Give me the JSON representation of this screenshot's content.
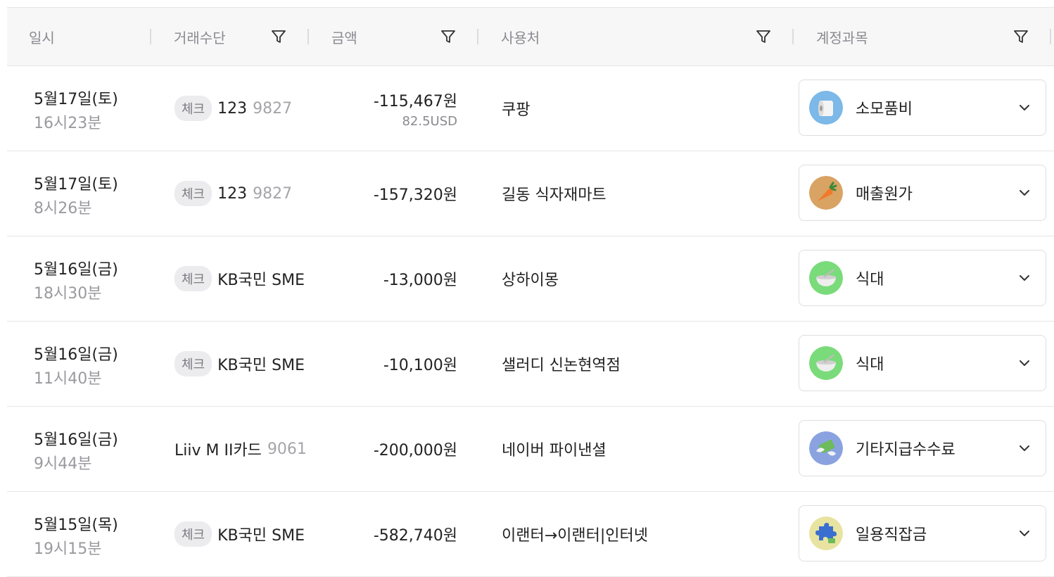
{
  "header": {
    "date": "일시",
    "method": "거래수단",
    "amount": "금액",
    "merchant": "사용처",
    "category": "계정과목"
  },
  "icons": {
    "filter": "filter-icon",
    "chevron": "chevron-down-icon"
  },
  "rows": [
    {
      "date": "5월17일(토)",
      "time": "16시23분",
      "chip": "체크",
      "method": "123",
      "account": "9827",
      "amount": "-115,467원",
      "usd": "82.5USD",
      "merchant": "쿠팡",
      "category": "소모품비",
      "category_icon": "toilet-paper-icon",
      "category_color": "#7cb8e8"
    },
    {
      "date": "5월17일(토)",
      "time": "8시26분",
      "chip": "체크",
      "method": "123",
      "account": "9827",
      "amount": "-157,320원",
      "merchant": "길동 식자재마트",
      "category": "매출원가",
      "category_icon": "carrot-icon",
      "category_color": "#d9a364"
    },
    {
      "date": "5월16일(금)",
      "time": "18시30분",
      "chip": "체크",
      "method": "KB국민 SME",
      "account": "",
      "amount": "-13,000원",
      "merchant": "상하이몽",
      "category": "식대",
      "category_icon": "bowl-icon",
      "category_color": "#7adb7a"
    },
    {
      "date": "5월16일(금)",
      "time": "11시40분",
      "chip": "체크",
      "method": "KB국민 SME",
      "account": "",
      "amount": "-10,100원",
      "merchant": "샐러디 신논현역점",
      "category": "식대",
      "category_icon": "bowl-icon",
      "category_color": "#7adb7a"
    },
    {
      "date": "5월16일(금)",
      "time": "9시44분",
      "chip": "",
      "method": "Liiv M II카드",
      "account": "9061",
      "amount": "-200,000원",
      "merchant": "네이버 파이낸셜",
      "category": "기타지급수수료",
      "category_icon": "money-wings-icon",
      "category_color": "#8aa3e0"
    },
    {
      "date": "5월15일(목)",
      "time": "19시15분",
      "chip": "체크",
      "method": "KB국민 SME",
      "account": "",
      "amount": "-582,740원",
      "merchant": "이랜터→이랜터|인터넷",
      "category": "일용직잡금",
      "category_icon": "puzzle-icon",
      "category_color": "#e8e3a0"
    }
  ]
}
